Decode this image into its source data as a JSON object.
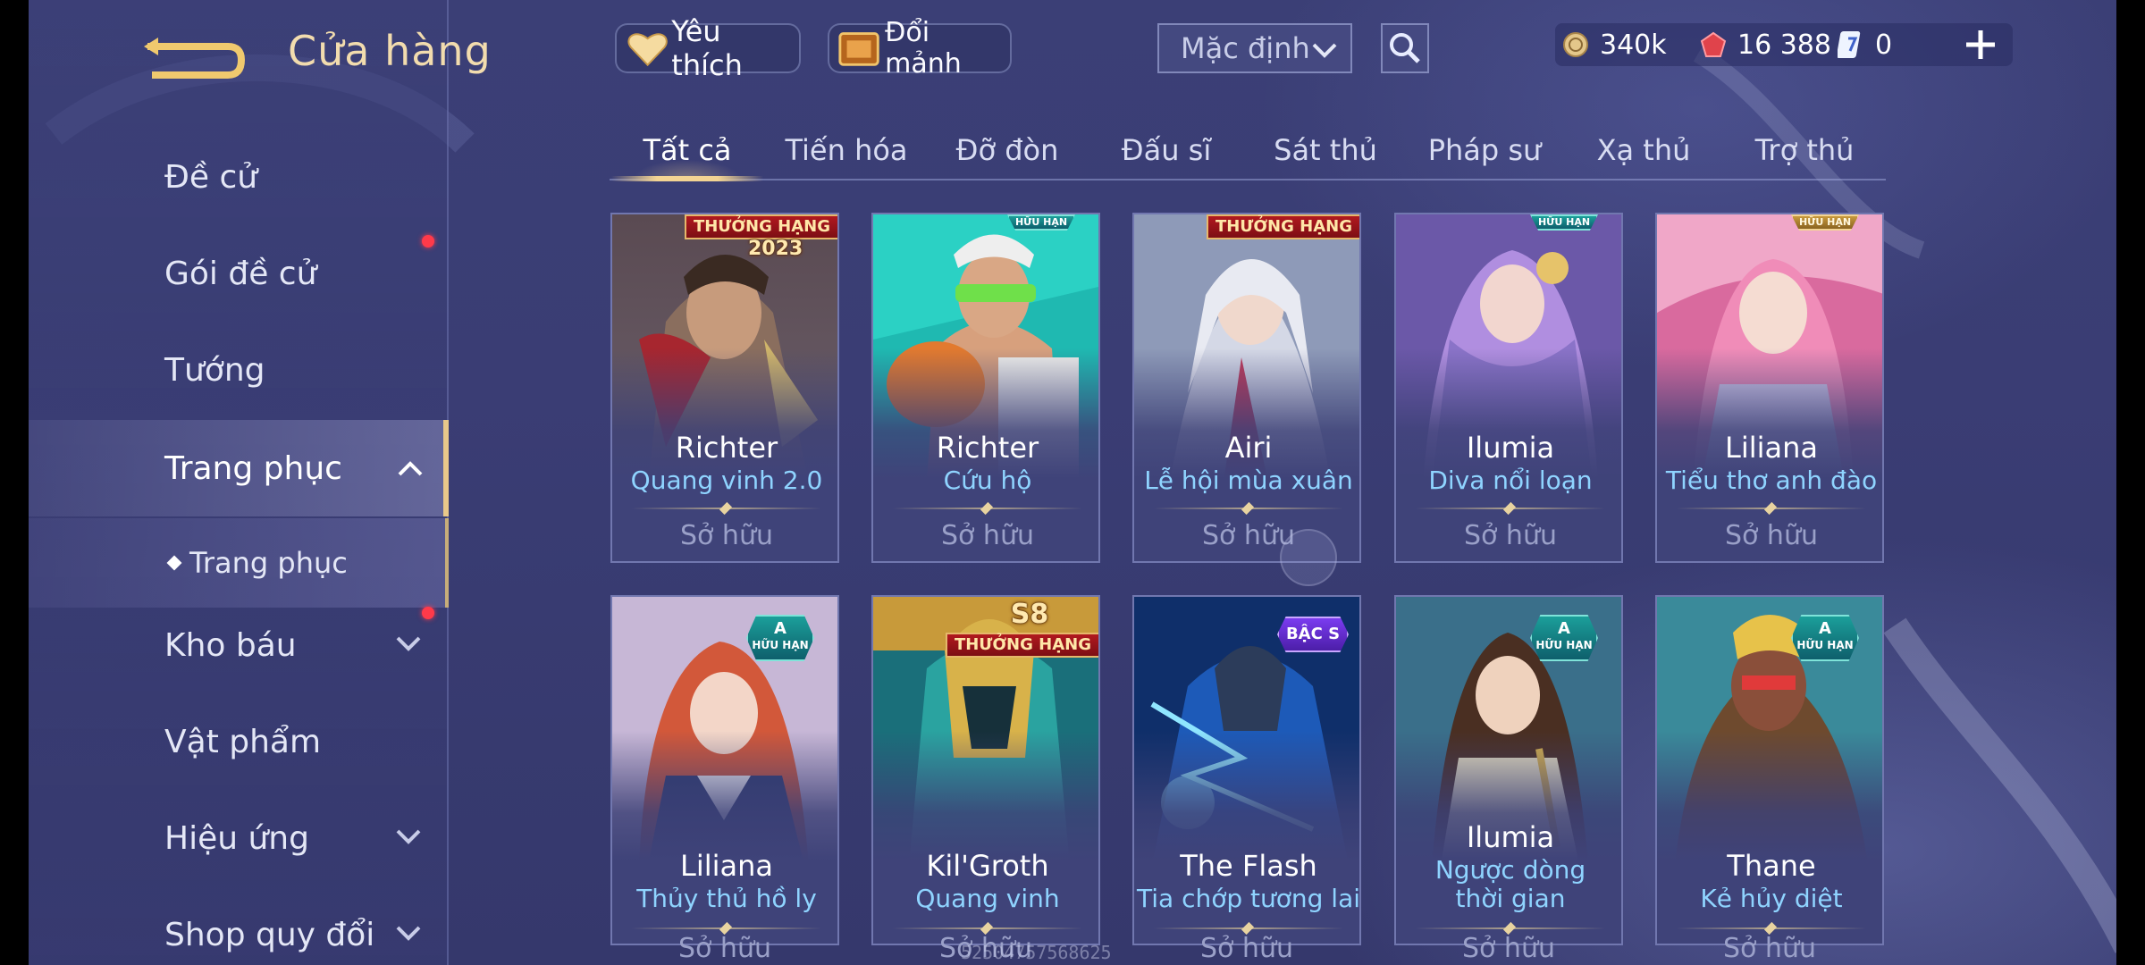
{
  "header": {
    "title": "Cửa hàng",
    "favorites_label": "Yêu thích",
    "exchange_label": "Đổi mảnh",
    "sort_value": "Mặc định",
    "currencies": {
      "gold": "340k",
      "rubies": "16 388",
      "tokens": "0"
    }
  },
  "sidebar": {
    "items": [
      {
        "label": "Đề cử"
      },
      {
        "label": "Gói đề cử"
      },
      {
        "label": "Tướng"
      },
      {
        "label": "Trang phục"
      },
      {
        "label": "Trang phục"
      },
      {
        "label": "Kho báu"
      },
      {
        "label": "Vật phẩm"
      },
      {
        "label": "Hiệu ứng"
      },
      {
        "label": "Shop quy đổi"
      }
    ]
  },
  "tabs": [
    "Tất cả",
    "Tiến hóa",
    "Đỡ đòn",
    "Đấu sĩ",
    "Sát thủ",
    "Pháp sư",
    "Xạ thủ",
    "Trợ thủ"
  ],
  "cards": [
    {
      "hero": "Richter",
      "skin": "Quang vinh 2.0",
      "status": "Sở hữu",
      "badge": "THƯỞNG HẠNG",
      "badge2": "2023"
    },
    {
      "hero": "Richter",
      "skin": "Cứu hộ",
      "status": "Sở hữu",
      "badge": "HỮU HẠN"
    },
    {
      "hero": "Airi",
      "skin": "Lễ hội mùa xuân",
      "status": "Sở hữu",
      "badge": "THƯỞNG HẠNG"
    },
    {
      "hero": "Ilumia",
      "skin": "Diva nổi loạn",
      "status": "Sở hữu",
      "badge": "HỮU HẠN"
    },
    {
      "hero": "Liliana",
      "skin": "Tiểu thơ anh đào",
      "status": "Sở hữu",
      "badge": "HỮU HẠN"
    },
    {
      "hero": "Liliana",
      "skin": "Thủy thủ hồ ly",
      "status": "Sở hữu",
      "badge_a": "A",
      "badge": "HỮU HẠN"
    },
    {
      "hero": "Kil'Groth",
      "skin": "Quang vinh",
      "status": "Sở hữu",
      "badge2": "S8",
      "badge": "THƯỞNG HẠNG"
    },
    {
      "hero": "The Flash",
      "skin": "Tia chớp tương lai",
      "status": "Sở hữu",
      "badge": "BẬC S"
    },
    {
      "hero": "Ilumia",
      "skin": "Ngược dòng thời gian",
      "status": "Sở hữu",
      "badge_a": "A",
      "badge": "HỮU HẠN"
    },
    {
      "hero": "Thane",
      "skin": "Kẻ hủy diệt",
      "status": "Sở hữu",
      "badge_a": "A",
      "badge": "HỮU HẠN"
    }
  ],
  "watermark": "52504757568625",
  "colors": {
    "accent_gold": "#f3d493",
    "skin_name": "#8fd4ff",
    "notify": "#ff3a4a"
  },
  "icons": [
    "back-arrow-icon",
    "heart-icon",
    "chest-icon",
    "chevron-down-icon",
    "search-icon",
    "gold-coin-icon",
    "ruby-icon",
    "token-icon",
    "plus-icon",
    "chevron-up-icon"
  ]
}
